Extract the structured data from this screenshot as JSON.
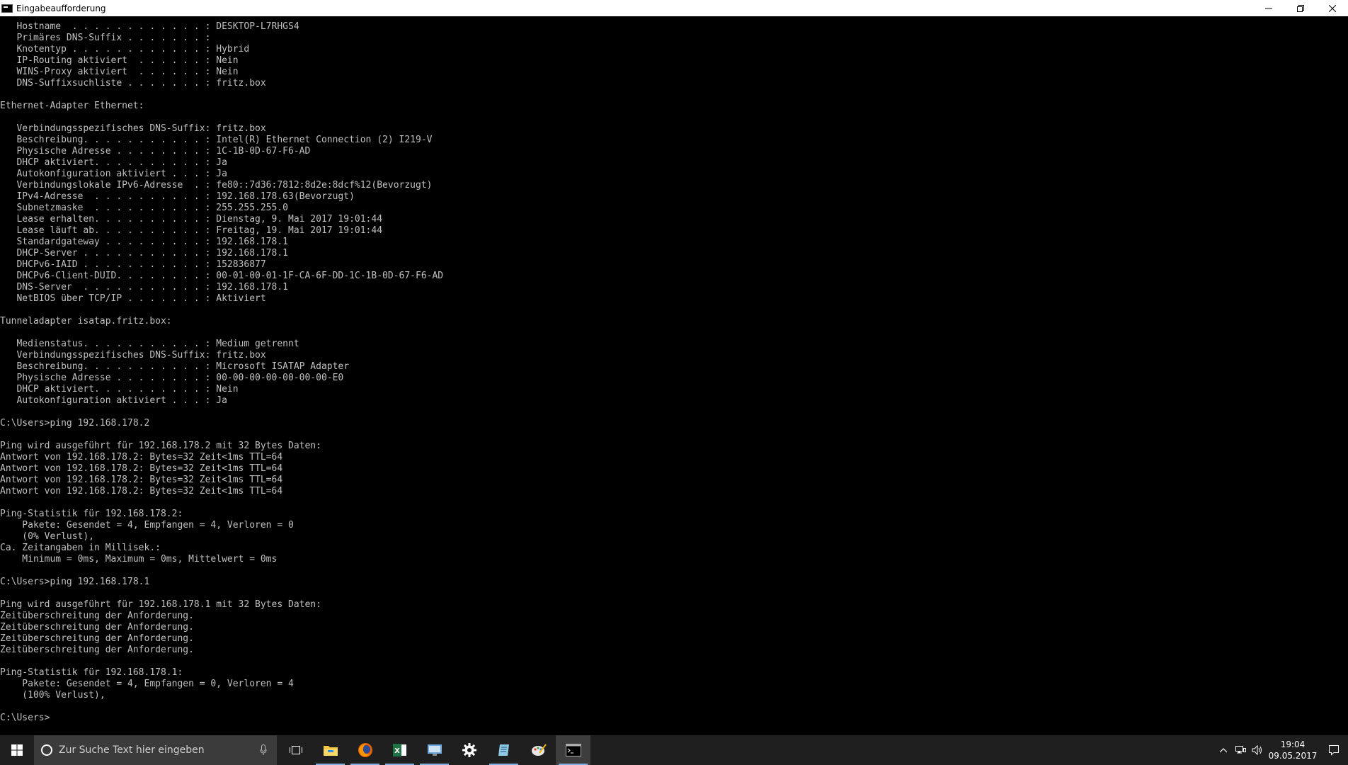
{
  "window": {
    "title": "Eingabeaufforderung",
    "minimize_glyph": "—",
    "maximize_glyph": "❐",
    "close_glyph": "✕"
  },
  "console": {
    "text": "   Hostname  . . . . . . . . . . . . : DESKTOP-L7RHGS4\n   Primäres DNS-Suffix . . . . . . . :\n   Knotentyp . . . . . . . . . . . . : Hybrid\n   IP-Routing aktiviert  . . . . . . : Nein\n   WINS-Proxy aktiviert  . . . . . . : Nein\n   DNS-Suffixsuchliste . . . . . . . : fritz.box\n\nEthernet-Adapter Ethernet:\n\n   Verbindungsspezifisches DNS-Suffix: fritz.box\n   Beschreibung. . . . . . . . . . . : Intel(R) Ethernet Connection (2) I219-V\n   Physische Adresse . . . . . . . . : 1C-1B-0D-67-F6-AD\n   DHCP aktiviert. . . . . . . . . . : Ja\n   Autokonfiguration aktiviert . . . : Ja\n   Verbindungslokale IPv6-Adresse  . : fe80::7d36:7812:8d2e:8dcf%12(Bevorzugt)\n   IPv4-Adresse  . . . . . . . . . . : 192.168.178.63(Bevorzugt)\n   Subnetzmaske  . . . . . . . . . . : 255.255.255.0\n   Lease erhalten. . . . . . . . . . : Dienstag, 9. Mai 2017 19:01:44\n   Lease läuft ab. . . . . . . . . . : Freitag, 19. Mai 2017 19:01:44\n   Standardgateway . . . . . . . . . : 192.168.178.1\n   DHCP-Server . . . . . . . . . . . : 192.168.178.1\n   DHCPv6-IAID . . . . . . . . . . . : 152836877\n   DHCPv6-Client-DUID. . . . . . . . : 00-01-00-01-1F-CA-6F-DD-1C-1B-0D-67-F6-AD\n   DNS-Server  . . . . . . . . . . . : 192.168.178.1\n   NetBIOS über TCP/IP . . . . . . . : Aktiviert\n\nTunneladapter isatap.fritz.box:\n\n   Medienstatus. . . . . . . . . . . : Medium getrennt\n   Verbindungsspezifisches DNS-Suffix: fritz.box\n   Beschreibung. . . . . . . . . . . : Microsoft ISATAP Adapter\n   Physische Adresse . . . . . . . . : 00-00-00-00-00-00-00-E0\n   DHCP aktiviert. . . . . . . . . . : Nein\n   Autokonfiguration aktiviert . . . : Ja\n\nC:\\Users>ping 192.168.178.2\n\nPing wird ausgeführt für 192.168.178.2 mit 32 Bytes Daten:\nAntwort von 192.168.178.2: Bytes=32 Zeit<1ms TTL=64\nAntwort von 192.168.178.2: Bytes=32 Zeit<1ms TTL=64\nAntwort von 192.168.178.2: Bytes=32 Zeit<1ms TTL=64\nAntwort von 192.168.178.2: Bytes=32 Zeit<1ms TTL=64\n\nPing-Statistik für 192.168.178.2:\n    Pakete: Gesendet = 4, Empfangen = 4, Verloren = 0\n    (0% Verlust),\nCa. Zeitangaben in Millisek.:\n    Minimum = 0ms, Maximum = 0ms, Mittelwert = 0ms\n\nC:\\Users>ping 192.168.178.1\n\nPing wird ausgeführt für 192.168.178.1 mit 32 Bytes Daten:\nZeitüberschreitung der Anforderung.\nZeitüberschreitung der Anforderung.\nZeitüberschreitung der Anforderung.\nZeitüberschreitung der Anforderung.\n\nPing-Statistik für 192.168.178.1:\n    Pakete: Gesendet = 4, Empfangen = 0, Verloren = 4\n    (100% Verlust),\n\nC:\\Users>"
  },
  "taskbar": {
    "search_placeholder": "Zur Suche Text hier eingeben",
    "apps": [
      {
        "name": "task-view-icon"
      },
      {
        "name": "file-explorer-icon"
      },
      {
        "name": "firefox-icon"
      },
      {
        "name": "excel-icon"
      },
      {
        "name": "network-app-icon"
      },
      {
        "name": "settings-gear-icon"
      },
      {
        "name": "notepad-icon"
      },
      {
        "name": "paint-icon"
      },
      {
        "name": "command-prompt-icon"
      }
    ],
    "tray": {
      "chevron_glyph": "^",
      "time": "19:04",
      "date": "09.05.2017"
    }
  },
  "colors": {
    "console_bg": "#000000",
    "console_fg": "#c0c0c0",
    "taskbar_bg": "#1f1f1f",
    "search_bg": "#3b3b3b",
    "accent": "#7fb0e0"
  }
}
